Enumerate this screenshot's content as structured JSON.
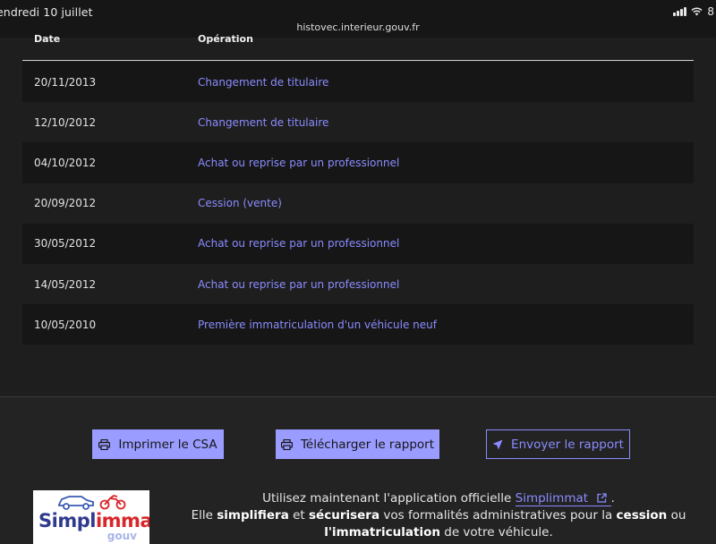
{
  "status_bar": {
    "date": "endredi 10 juillet",
    "url": "histovec.interieur.gouv.fr",
    "battery": "8"
  },
  "table": {
    "headers": {
      "date": "Date",
      "operation": "Opération"
    },
    "rows": [
      {
        "date": "20/11/2013",
        "operation": "Changement de titulaire"
      },
      {
        "date": "12/10/2012",
        "operation": "Changement de titulaire"
      },
      {
        "date": "04/10/2012",
        "operation": "Achat ou reprise par un professionnel"
      },
      {
        "date": "20/09/2012",
        "operation": "Cession (vente)"
      },
      {
        "date": "30/05/2012",
        "operation": "Achat ou reprise par un professionnel"
      },
      {
        "date": "14/05/2012",
        "operation": "Achat ou reprise par un professionnel"
      },
      {
        "date": "10/05/2010",
        "operation": "Première immatriculation d'un véhicule neuf"
      }
    ]
  },
  "actions": {
    "print_label": "Imprimer le CSA",
    "download_label": "Télécharger le rapport",
    "send_label": "Envoyer le rapport"
  },
  "promo": {
    "logo_simpl": "Simpl",
    "logo_immat": "immat",
    "logo_gouv": "gouv",
    "line1_prefix": "Utilisez maintenant l'application officielle ",
    "line1_link": "Simplimmat",
    "line1_suffix": ".",
    "line2_prefix": "Elle ",
    "line2_bold1": "simplifiera",
    "line2_mid1": " et ",
    "line2_bold2": "sécurisera",
    "line2_mid2": " vos formalités administratives pour la ",
    "line2_bold3": "cession",
    "line2_suffix": " ou",
    "line3_bold": "l'immatriculation",
    "line3_suffix": " de votre véhicule."
  },
  "colors": {
    "accent": "#8a8cff",
    "button_fill": "#9a9cff",
    "background": "#232323"
  }
}
